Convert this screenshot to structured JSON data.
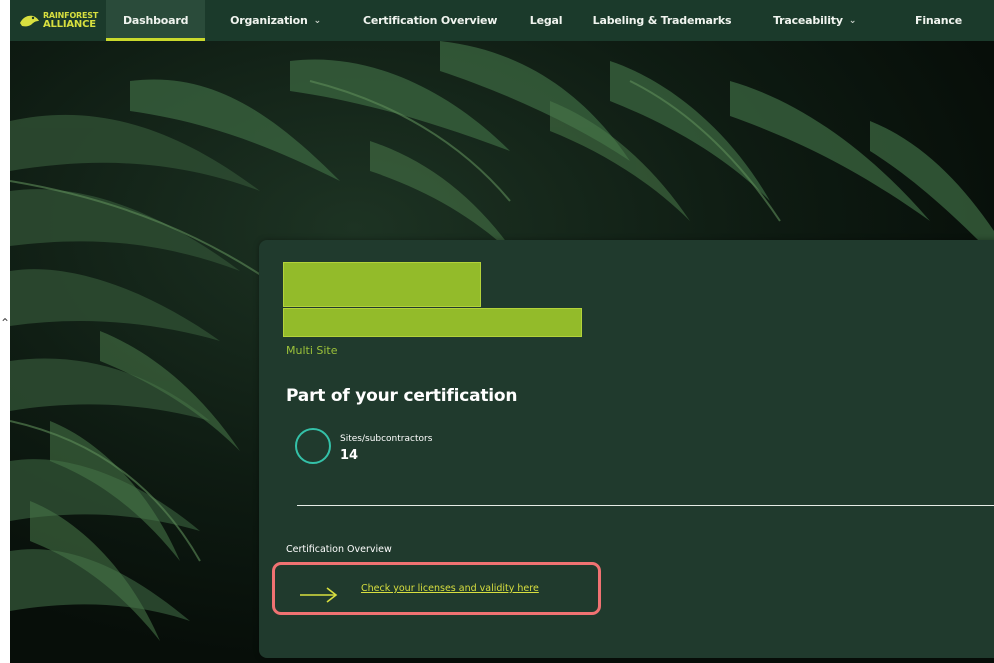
{
  "brand": {
    "line1": "RAINFOREST",
    "line2": "ALLIANCE",
    "accent": "#d8df3f",
    "nav_bg": "#1b3a2b"
  },
  "nav": {
    "items": [
      {
        "label": "Dashboard",
        "active": true,
        "dropdown": false
      },
      {
        "label": "Organization",
        "active": false,
        "dropdown": true
      },
      {
        "label": "Certification Overview",
        "active": false,
        "dropdown": false
      },
      {
        "label": "Legal",
        "active": false,
        "dropdown": false
      },
      {
        "label": "Labeling & Trademarks",
        "active": false,
        "dropdown": false
      },
      {
        "label": "Traceability",
        "active": false,
        "dropdown": true
      },
      {
        "label": "Finance",
        "active": false,
        "dropdown": false
      }
    ]
  },
  "card": {
    "site_type": "Multi Site",
    "section_title": "Part of your certification",
    "metric": {
      "label": "Sites/subcontractors",
      "value": "14",
      "ring_color": "#34c1a8"
    },
    "overview_label": "Certification Overview",
    "cta_label": "Check your licenses and validity here",
    "highlight_color": "#f07272",
    "redaction_color": "#93bb2a"
  }
}
